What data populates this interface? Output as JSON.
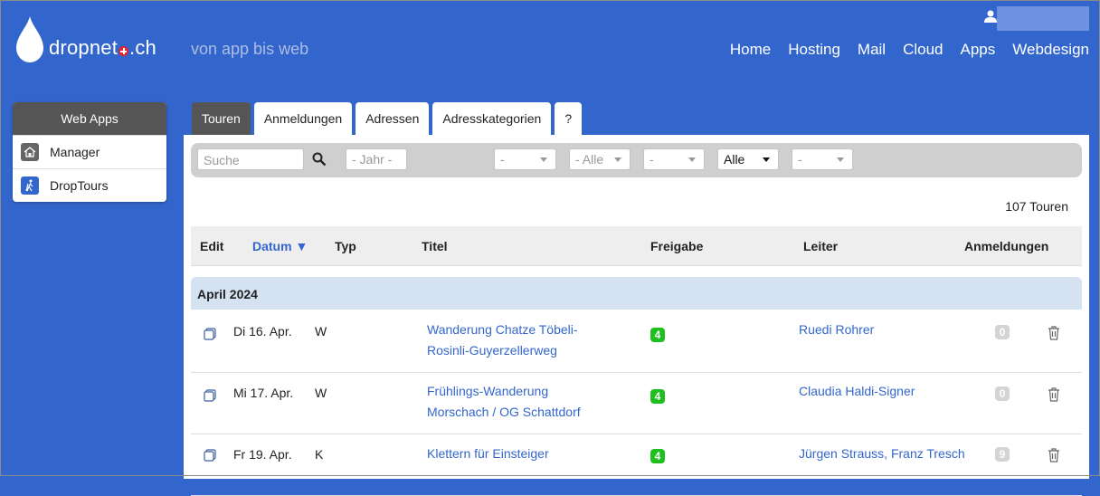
{
  "header": {
    "brand_name": "dropnet",
    "brand_tld": "ch",
    "tagline": "von app bis web",
    "nav": [
      "Home",
      "Hosting",
      "Mail",
      "Cloud",
      "Apps",
      "Webdesign"
    ]
  },
  "sidebar": {
    "title": "Web Apps",
    "items": [
      {
        "label": "Manager",
        "icon": "house-icon"
      },
      {
        "label": "DropTours",
        "icon": "hiker-icon"
      }
    ]
  },
  "tabs": [
    "Touren",
    "Anmeldungen",
    "Adressen",
    "Adresskategorien",
    "?"
  ],
  "active_tab": "Touren",
  "filters": {
    "search_placeholder": "Suche",
    "year": "- Jahr -",
    "select1": "-",
    "select2": "- Alle",
    "select3": "-",
    "select4": "Alle",
    "select5": "-"
  },
  "count_text": "107 Touren",
  "columns": {
    "edit": "Edit",
    "datum": "Datum",
    "typ": "Typ",
    "titel": "Titel",
    "freigabe": "Freigabe",
    "leiter": "Leiter",
    "anmeldungen": "Anmeldungen"
  },
  "group": "April 2024",
  "rows": [
    {
      "date": "Di 16. Apr.",
      "typ": "W",
      "title_line1": "Wanderung Chatze Töbeli-",
      "title_line2": "Rosinli-Guyerzellerweg",
      "freigabe": "4",
      "leiter": "Ruedi Rohrer",
      "anmeldungen": "0"
    },
    {
      "date": "Mi 17. Apr.",
      "typ": "W",
      "title_line1": "Frühlings-Wanderung",
      "title_line2": "Morschach / OG Schattdorf",
      "freigabe": "4",
      "leiter": "Claudia Haldi-Signer",
      "anmeldungen": "0"
    },
    {
      "date": "Fr 19. Apr.",
      "typ": "K",
      "title_line1": "Klettern für Einsteiger",
      "title_line2": "",
      "freigabe": "4",
      "leiter": "Jürgen Strauss, Franz Tresch",
      "anmeldungen": "9"
    }
  ],
  "colors": {
    "brand_blue": "#3366cc",
    "dark_tab": "#555555",
    "release_green": "#1fbf1f"
  }
}
